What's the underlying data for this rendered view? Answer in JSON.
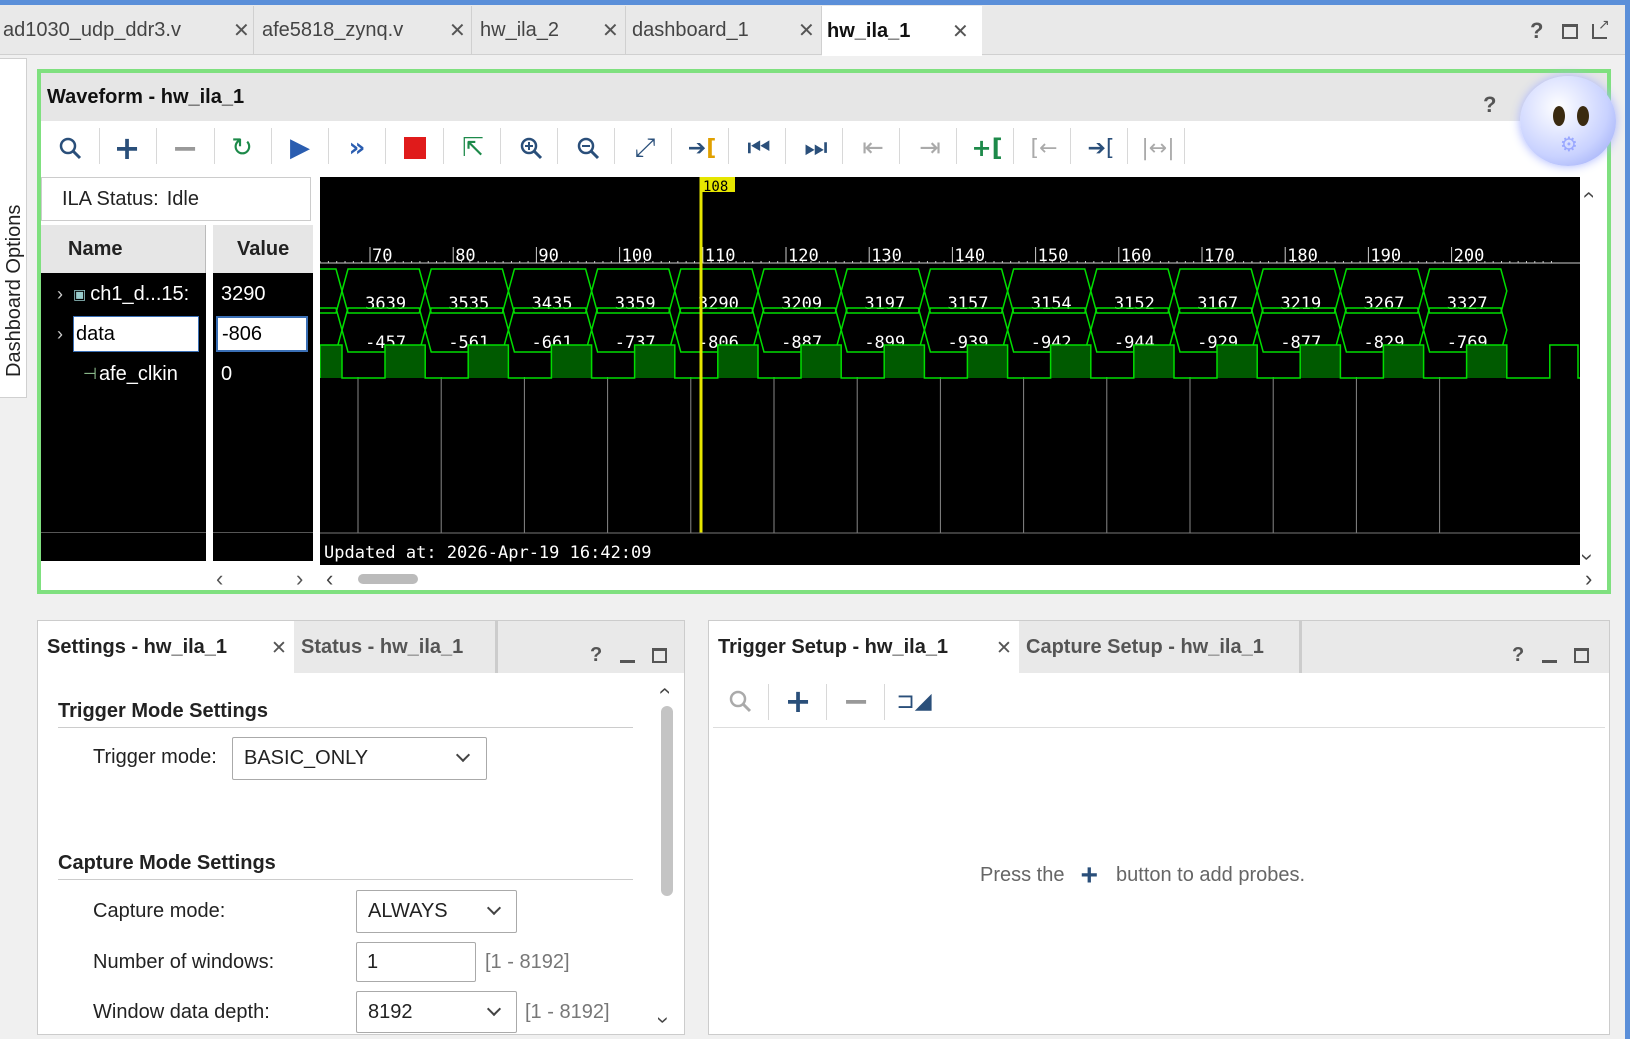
{
  "editor_tabs": [
    {
      "label": "ad1030_udp_ddr3.v",
      "active": false
    },
    {
      "label": "afe5818_zynq.v",
      "active": false
    },
    {
      "label": "hw_ila_2",
      "active": false
    },
    {
      "label": "dashboard_1",
      "active": false
    },
    {
      "label": "hw_ila_1",
      "active": true
    }
  ],
  "window_controls": {
    "help": "?"
  },
  "side_tab": "Dashboard Options",
  "waveform": {
    "title": "Waveform - hw_ila_1",
    "help": "?",
    "toolbar_icons": [
      "search-icon",
      "add-icon",
      "remove-icon",
      "refresh-icon",
      "run-trigger-icon",
      "run-immediate-icon",
      "stop-icon",
      "export-icon",
      "zoom-in-icon",
      "zoom-out-icon",
      "zoom-fit-icon",
      "go-to-cursor-icon",
      "go-to-start-icon",
      "go-to-end-icon",
      "previous-transition-icon",
      "next-transition-icon",
      "add-marker-icon",
      "previous-marker-icon",
      "next-marker-icon",
      "swap-cursors-icon"
    ],
    "ila_status_label": "ILA Status:",
    "ila_status_value": "Idle",
    "name_header": "Name",
    "value_header": "Value",
    "signals": [
      {
        "name": "ch1_d...15:",
        "value": "3290",
        "expandable": true,
        "icon": "bus-icon"
      },
      {
        "name": "data",
        "value": "-806",
        "expandable": true,
        "icon": "",
        "selected": true
      },
      {
        "name": "afe_clkin",
        "value": "0",
        "expandable": false,
        "icon": "wire-icon"
      }
    ],
    "cursor_label": "108",
    "timeline_ticks": [
      "70",
      "80",
      "90",
      "100",
      "110",
      "120",
      "130",
      "140",
      "150",
      "160",
      "170",
      "180",
      "190",
      "200"
    ],
    "bus1_values": [
      "3639",
      "3535",
      "3435",
      "3359",
      "3290",
      "3209",
      "3197",
      "3157",
      "3154",
      "3152",
      "3167",
      "3219",
      "3267",
      "3327"
    ],
    "bus2_values": [
      "-457",
      "-561",
      "-661",
      "-737",
      "-806",
      "-887",
      "-899",
      "-939",
      "-942",
      "-944",
      "-929",
      "-877",
      "-829",
      "-769"
    ],
    "updated_at": "Updated at: 2026-Apr-19 16:42:09",
    "colors": {
      "wave": "#00dd00",
      "cursor": "#e6e600",
      "background": "#000000",
      "frame": "#7fe07f"
    }
  },
  "settings_panel": {
    "tabs": [
      {
        "label": "Settings - hw_ila_1",
        "active": true
      },
      {
        "label": "Status - hw_ila_1",
        "active": false
      }
    ],
    "help": "?",
    "trigger_section": "Trigger Mode Settings",
    "trigger_mode_label": "Trigger mode:",
    "trigger_mode_value": "BASIC_ONLY",
    "capture_section": "Capture Mode Settings",
    "capture_mode_label": "Capture mode:",
    "capture_mode_value": "ALWAYS",
    "windows_label": "Number of windows:",
    "windows_value": "1",
    "windows_range": "[1 - 8192]",
    "depth_label": "Window data depth:",
    "depth_value": "8192",
    "depth_range": "[1 - 8192]"
  },
  "trigger_panel": {
    "tabs": [
      {
        "label": "Trigger Setup - hw_ila_1",
        "active": true
      },
      {
        "label": "Capture Setup - hw_ila_1",
        "active": false
      }
    ],
    "help": "?",
    "empty_before": "Press the",
    "empty_after": "button to add probes."
  }
}
